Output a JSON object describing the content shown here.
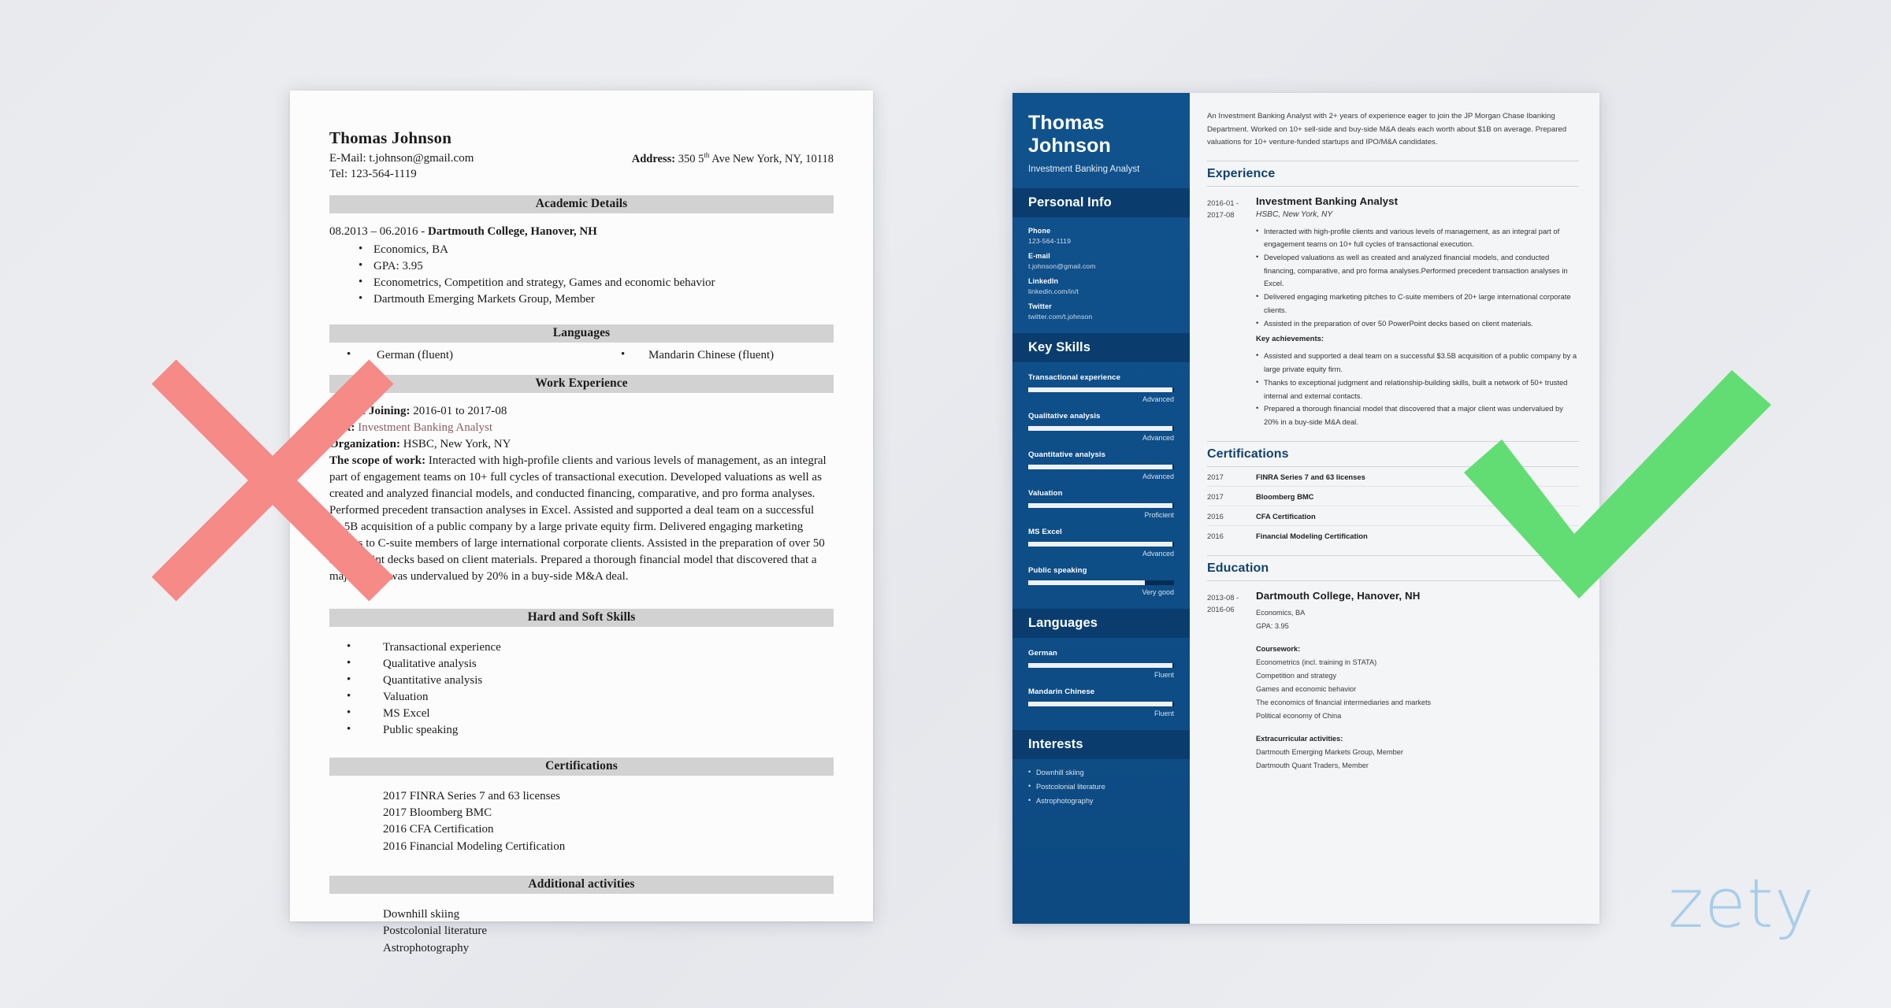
{
  "left_resume": {
    "name": "Thomas Johnson",
    "email_line": "E-Mail: t.johnson@gmail.com",
    "tel_line": "Tel: 123-564-1119",
    "address_label": "Address:",
    "address_value_pre": "350 5",
    "address_sup": "th",
    "address_value_post": " Ave New York, NY, 10118",
    "sections": {
      "academic": "Academic Details",
      "languages": "Languages",
      "work": "Work Experience",
      "skills": "Hard and Soft Skills",
      "certifications": "Certifications",
      "additional": "Additional activities"
    },
    "academic": {
      "headline_dates": "08.2013 – 06.2016 - ",
      "headline_school": "Dartmouth College, Hanover, NH",
      "bullets": [
        "Economics, BA",
        "GPA: 3.95",
        "Econometrics, Competition and strategy, Games and economic behavior",
        "Dartmouth Emerging Markets Group, Member"
      ]
    },
    "languages": [
      "German (fluent)",
      "Mandarin Chinese (fluent)"
    ],
    "work": {
      "date_label": "Date of Joining:",
      "date_value": " 2016-01 to 2017-08",
      "post_label": "Post:",
      "post_value": " Investment Banking Analyst",
      "org_label": "Organization:",
      "org_value": " HSBC, New York, NY",
      "scope_label": "The scope of work:",
      "scope_value": " Interacted with high-profile clients and various levels of management, as an integral part of engagement teams on 10+ full cycles of transactional execution. Developed valuations as well as created and analyzed financial models, and conducted financing, comparative, and pro forma analyses. Performed precedent transaction analyses in Excel. Assisted and supported a deal team on a successful $3.5B acquisition of a public company by a large private equity firm. Delivered engaging marketing pitches to C-suite members of large international corporate clients. Assisted in the preparation of over 50 PowerPoint decks based on client materials. Prepared a thorough financial model that discovered that a major client was undervalued by 20% in a buy-side M&A deal."
    },
    "skills": [
      "Transactional experience",
      "Qualitative analysis",
      "Quantitative analysis",
      "Valuation",
      "MS Excel",
      "Public speaking"
    ],
    "certifications": [
      "2017 FINRA Series 7 and 63 licenses",
      "2017 Bloomberg BMC",
      "2016 CFA Certification",
      "2016 Financial Modeling Certification"
    ],
    "additional": [
      "Downhill skiing",
      "Postcolonial literature",
      "Astrophotography"
    ]
  },
  "right_resume": {
    "sidebar": {
      "name_line1": "Thomas",
      "name_line2": "Johnson",
      "job_title": "Investment Banking Analyst",
      "personal_info_title": "Personal Info",
      "contacts": [
        {
          "label": "Phone",
          "value": "123-564-1119"
        },
        {
          "label": "E-mail",
          "value": "t.johnson@gmail.com"
        },
        {
          "label": "LinkedIn",
          "value": "linkedin.com/in/t"
        },
        {
          "label": "Twitter",
          "value": "twitter.com/t.johnson"
        }
      ],
      "key_skills_title": "Key Skills",
      "skills": [
        {
          "name": "Transactional experience",
          "level": "Advanced",
          "pct": 99
        },
        {
          "name": "Qualitative analysis",
          "level": "Advanced",
          "pct": 99
        },
        {
          "name": "Quantitative analysis",
          "level": "Advanced",
          "pct": 99
        },
        {
          "name": "Valuation",
          "level": "Proficient",
          "pct": 99
        },
        {
          "name": "MS Excel",
          "level": "Advanced",
          "pct": 99
        },
        {
          "name": "Public speaking",
          "level": "Very good",
          "pct": 80
        }
      ],
      "languages_title": "Languages",
      "languages": [
        {
          "name": "German",
          "level": "Fluent",
          "pct": 99
        },
        {
          "name": "Mandarin Chinese",
          "level": "Fluent",
          "pct": 99
        }
      ],
      "interests_title": "Interests",
      "interests": [
        "Downhill skiing",
        "Postcolonial literature",
        "Astrophotography"
      ]
    },
    "main": {
      "summary": "An Investment Banking Analyst with 2+ years of experience eager to join the JP Morgan Chase Ibanking Department. Worked on 10+ sell-side and buy-side M&A deals each worth about $1B on average. Prepared valuations for 10+ venture-funded startups and IPO/M&A candidates.",
      "experience_title": "Experience",
      "experience": {
        "date_from": "2016-01 -",
        "date_to": "2017-08",
        "title": "Investment Banking Analyst",
        "org": "HSBC, New York, NY",
        "bullets": [
          "Interacted with high-profile clients and various levels of management, as an integral part of engagement teams on 10+ full cycles of transactional execution.",
          "Developed valuations as well as created and analyzed financial models, and conducted financing, comparative, and pro forma analyses.Performed precedent transaction analyses in Excel.",
          "Delivered engaging marketing pitches to C-suite members of 20+ large international corporate clients.",
          "Assisted in the preparation of over 50 PowerPoint decks based on client materials."
        ],
        "achievements_label": "Key achievements:",
        "achievements": [
          "Assisted and supported a deal team on a successful $3.5B acquisition of a public company by a large private equity firm.",
          "Thanks to exceptional judgment and relationship-building skills, built a network of 50+ trusted internal and external contacts.",
          "Prepared a thorough financial model that discovered that a major client was undervalued by 20% in a buy-side M&A deal."
        ]
      },
      "certifications_title": "Certifications",
      "certifications": [
        {
          "year": "2017",
          "name": "FINRA Series 7 and 63 licenses"
        },
        {
          "year": "2017",
          "name": "Bloomberg BMC"
        },
        {
          "year": "2016",
          "name": "CFA Certification"
        },
        {
          "year": "2016",
          "name": "Financial Modeling Certification"
        }
      ],
      "education_title": "Education",
      "education": {
        "date_from": "2013-08 -",
        "date_to": "2016-06",
        "school": "Dartmouth College, Hanover, NH",
        "degree": "Economics, BA",
        "gpa": "GPA: 3.95",
        "coursework_label": "Coursework:",
        "coursework": [
          "Econometrics (incl. training in STATA)",
          "Competition and strategy",
          "Games and economic behavior",
          "The economics of financial intermediaries and markets",
          "Political economy of China"
        ],
        "extracurricular_label": "Extracurricular activities:",
        "extracurricular": [
          "Dartmouth Emerging Markets Group, Member",
          "Dartmouth Quant Traders, Member"
        ]
      }
    }
  },
  "overlay": {
    "cross_mark": "red-x-mark",
    "check_mark": "green-check-mark",
    "watermark": "zety"
  },
  "colors": {
    "sidebar_blue": "#0e4d85",
    "sidebar_header_blue": "#0a3d6e",
    "heading_blue": "#12426e",
    "cross_red": "#f58a87",
    "check_green": "#62dd74",
    "watermark_blue": "#a8cdea",
    "grey_bar": "#d2d2d2"
  }
}
